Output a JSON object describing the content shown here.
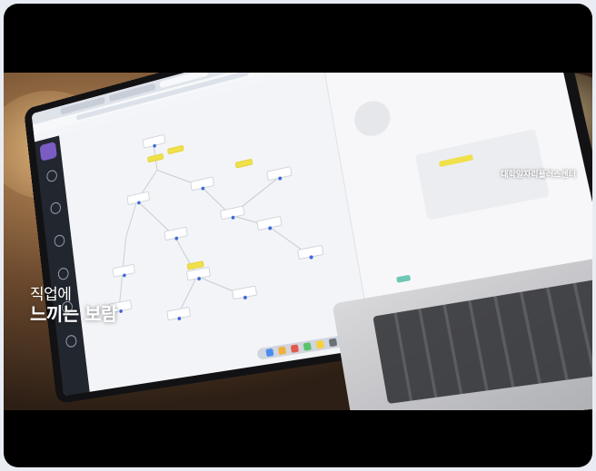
{
  "caption": {
    "line1": "직업에",
    "line2": "느끼는 보람"
  },
  "watermark": {
    "text": "대학일자리플러스센터"
  },
  "colors": {
    "letterbox": "#000000",
    "caption_text": "#ffffff",
    "app_accent": "#7b5cc4",
    "highlight_node": "#f0e04a"
  },
  "scene": {
    "subject": "laptop-showing-flowchart-app",
    "icons": [
      "app-logo-icon",
      "sidebar-nav-icon",
      "dock-icon"
    ]
  }
}
